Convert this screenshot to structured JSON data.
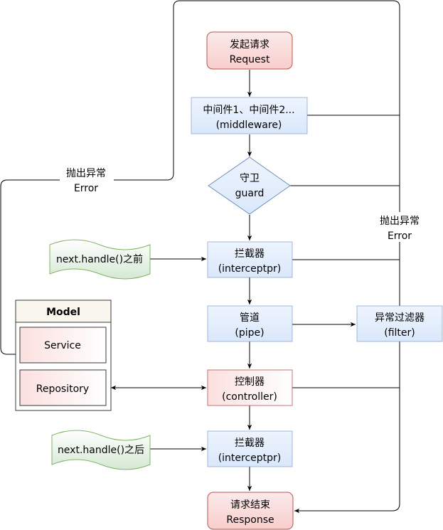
{
  "nodes": {
    "request": {
      "line1": "发起请求",
      "line2": "Request"
    },
    "middleware": {
      "line1": "中间件1、中间件2...",
      "line2": "(middleware)"
    },
    "guard": {
      "line1": "守卫",
      "line2": "guard"
    },
    "interceptor_before": {
      "line1": "拦截器",
      "line2": "(interceptpr)"
    },
    "pipe": {
      "line1": "管道",
      "line2": "(pipe)"
    },
    "filter": {
      "line1": "异常过滤器",
      "line2": "(filter)"
    },
    "controller": {
      "line1": "控制器",
      "line2": "(controller)"
    },
    "interceptor_after": {
      "line1": "拦截器",
      "line2": "(interceptpr)"
    },
    "response": {
      "line1": "请求结束",
      "line2": "Response"
    }
  },
  "notes": {
    "before": "next.handle()之前",
    "after": "next.handle()之后"
  },
  "model": {
    "title": "Model",
    "service": "Service",
    "repository": "Repository"
  },
  "errors": {
    "left": {
      "line1": "抛出异常",
      "line2": "Error"
    },
    "right": {
      "line1": "抛出异常",
      "line2": "Error"
    }
  },
  "colors": {
    "red_fill": "#f8cecc",
    "red_stroke": "#b85450",
    "blue_fill": "#dae8fc",
    "blue_stroke": "#6c8ebf",
    "green_fill": "#d5e8d4",
    "green_stroke": "#82b366",
    "model_header": "#f9f7ed",
    "model_stroke": "#36393d"
  }
}
